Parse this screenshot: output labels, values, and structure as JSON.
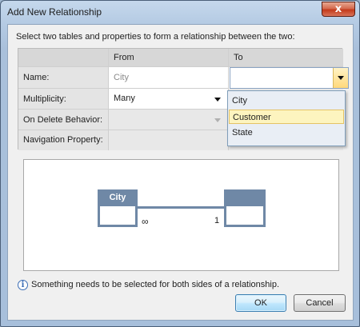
{
  "window": {
    "title": "Add New Relationship",
    "close_glyph": "x"
  },
  "instructions": "Select two tables and properties to form a relationship between the two:",
  "grid": {
    "headers": {
      "from": "From",
      "to": "To"
    },
    "rows": [
      {
        "label": "Name:",
        "from_value": "City",
        "to_value": ""
      },
      {
        "label": "Multiplicity:",
        "from_value": "Many",
        "to_value": ""
      },
      {
        "label": "On Delete Behavior:",
        "from_value": "",
        "to_value": ""
      },
      {
        "label": "Navigation Property:",
        "from_value": "",
        "to_value": ""
      }
    ]
  },
  "to_dropdown": {
    "options": [
      "City",
      "Customer",
      "State"
    ],
    "highlighted": "Customer"
  },
  "diagram": {
    "left_entity": "City",
    "right_entity": "",
    "left_multiplicity": "∞",
    "right_multiplicity": "1",
    "entity_color": "#6f88a6"
  },
  "info": {
    "icon": "info-icon",
    "message": "Something needs to be selected for both sides of a relationship."
  },
  "buttons": {
    "ok": "OK",
    "cancel": "Cancel"
  }
}
